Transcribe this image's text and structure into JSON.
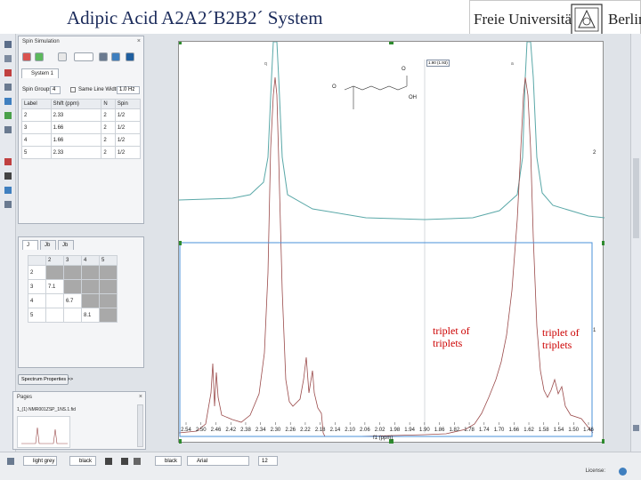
{
  "slide": {
    "title": "Adipic Acid  A2A2´B2B2´  System"
  },
  "logo": {
    "left_text": "Freie Universität",
    "right_text": "Berlin"
  },
  "colors": {
    "accent": "#1a2a5a",
    "annotation": "#cc0000",
    "spectrum_line": "#9a4a4a",
    "simulated_line": "#5aa8a8",
    "handle": "#2e8b2e"
  },
  "spin_panel": {
    "title": "Spin Simulation",
    "tab": "System 1",
    "spin_groups_label": "Spin Groups:",
    "spin_groups_value": "4",
    "same_line_width_label": "Same Line Width",
    "line_width_value": "1.0 Hz",
    "columns": [
      "Label",
      "Shift (ppm)",
      "N",
      "Spin"
    ],
    "rows": [
      [
        "2",
        "2.33",
        "2",
        "1/2"
      ],
      [
        "3",
        "1.66",
        "2",
        "1/2"
      ],
      [
        "4",
        "1.66",
        "2",
        "1/2"
      ],
      [
        "5",
        "2.33",
        "2",
        "1/2"
      ]
    ]
  },
  "coupling_panel": {
    "tabs": [
      "J",
      "Jb",
      "Jb"
    ],
    "header": [
      "",
      "2",
      "3",
      "4",
      "5"
    ],
    "rows": [
      [
        "2",
        "",
        "",
        "",
        ""
      ],
      [
        "3",
        "7.1",
        "",
        "",
        ""
      ],
      [
        "4",
        "",
        "6.7",
        "",
        ""
      ],
      [
        "5",
        "",
        "",
        "8.1",
        ""
      ]
    ],
    "spectrum_properties_button": "Spectrum Properties >>"
  },
  "pages_panel": {
    "title": "Pages",
    "item": "1_(1) NMR001ZSP_1NS.1.fid"
  },
  "plot": {
    "molecule_label": "OH",
    "oxygen_label": "O",
    "peak_label_left": "q",
    "peak_label_right": "a",
    "cursor_box": "1.90 (1.93)",
    "axis_title": "f1 (ppm)",
    "ticks": [
      "2.54",
      "2.50",
      "2.46",
      "2.42",
      "2.38",
      "2.34",
      "2.30",
      "2.26",
      "2.22",
      "2.18",
      "2.14",
      "2.10",
      "2.06",
      "2.02",
      "1.98",
      "1.94",
      "1.90",
      "1.86",
      "1.82",
      "1.78",
      "1.74",
      "1.70",
      "1.66",
      "1.62",
      "1.58",
      "1.54",
      "1.50",
      "1.46"
    ],
    "annotations": [
      "triplet of triplets",
      "triplet of triplets"
    ],
    "side_mark_2": "2",
    "side_mark_1": "1"
  },
  "bottom_toolbar": {
    "line_color": "light grey",
    "fill_color": "black",
    "text_color": "black",
    "font": "Arial",
    "font_size": "12"
  },
  "status": {
    "license": "License:"
  }
}
